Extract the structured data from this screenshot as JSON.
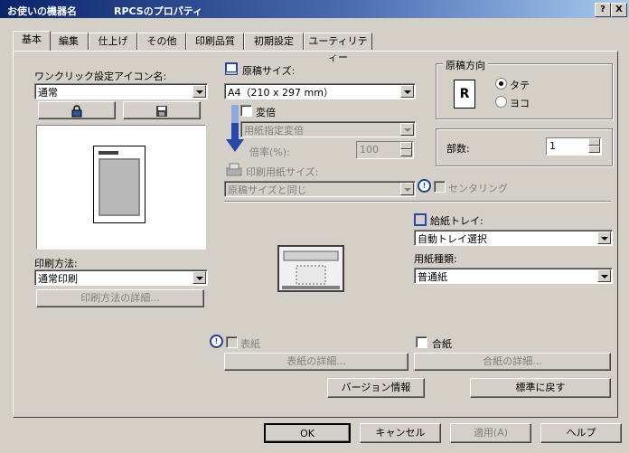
{
  "window": {
    "printer_name": "お使いの機器名",
    "title": "RPCSのプロパティ",
    "help_glyph": "?",
    "close_glyph": "X"
  },
  "tabs": [
    {
      "label": "基本",
      "active": true
    },
    {
      "label": "編集",
      "active": false
    },
    {
      "label": "仕上げ",
      "active": false
    },
    {
      "label": "その他",
      "active": false
    },
    {
      "label": "印刷品質",
      "active": false
    },
    {
      "label": "初期設定",
      "active": false
    },
    {
      "label": "ユーティリティー",
      "active": false
    }
  ],
  "one_click": {
    "label": "ワンクリック設定アイコン名:",
    "value": "通常"
  },
  "print_method": {
    "label": "印刷方法:",
    "value": "通常印刷",
    "details_button": "印刷方法の詳細..."
  },
  "original_size": {
    "label": "原稿サイズ:",
    "value": "A4（210 x 297 mm）"
  },
  "scale": {
    "label": "変倍",
    "mode_value": "用紙指定変倍",
    "ratio_label": "倍率(%):",
    "ratio_value": "100"
  },
  "print_paper_size": {
    "label": "印刷用紙サイズ:",
    "value": "原稿サイズと同じ"
  },
  "centering": {
    "label": "センタリング"
  },
  "orientation": {
    "label": "原稿方向",
    "icon_letter": "R",
    "options": [
      {
        "label": "タテ",
        "selected": true
      },
      {
        "label": "ヨコ",
        "selected": false
      }
    ]
  },
  "copies": {
    "label": "部数:",
    "value": "1"
  },
  "paper_tray": {
    "label": "給紙トレイ:",
    "value": "自動トレイ選択"
  },
  "paper_type": {
    "label": "用紙種類:",
    "value": "普通紙"
  },
  "cover": {
    "label": "表紙",
    "details_button": "表紙の詳細..."
  },
  "slip_sheet": {
    "label": "合紙",
    "details_button": "合紙の詳細..."
  },
  "version_button": "バージョン情報",
  "restore_defaults_button": "標準に戻す",
  "footer": {
    "ok": "OK",
    "cancel": "キャンセル",
    "apply": "適用(A)",
    "help": "ヘルプ"
  }
}
